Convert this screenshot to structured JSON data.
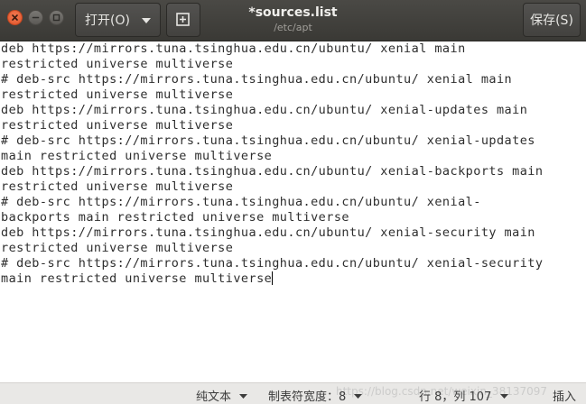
{
  "window": {
    "title": "*sources.list",
    "subtitle": "/etc/apt"
  },
  "header": {
    "open_label": "打开(O)",
    "save_label": "保存(S)"
  },
  "editor": {
    "lines": [
      "deb https://mirrors.tuna.tsinghua.edu.cn/ubuntu/ xenial main",
      "restricted universe multiverse",
      "# deb-src https://mirrors.tuna.tsinghua.edu.cn/ubuntu/ xenial main",
      "restricted universe multiverse",
      "deb https://mirrors.tuna.tsinghua.edu.cn/ubuntu/ xenial-updates main",
      "restricted universe multiverse",
      "# deb-src https://mirrors.tuna.tsinghua.edu.cn/ubuntu/ xenial-updates",
      "main restricted universe multiverse",
      "deb https://mirrors.tuna.tsinghua.edu.cn/ubuntu/ xenial-backports main",
      "restricted universe multiverse",
      "# deb-src https://mirrors.tuna.tsinghua.edu.cn/ubuntu/ xenial-",
      "backports main restricted universe multiverse",
      "deb https://mirrors.tuna.tsinghua.edu.cn/ubuntu/ xenial-security main",
      "restricted universe multiverse",
      "# deb-src https://mirrors.tuna.tsinghua.edu.cn/ubuntu/ xenial-security",
      "main restricted universe multiverse"
    ]
  },
  "status": {
    "language": "纯文本",
    "tab_width": "制表符宽度：8",
    "position": "行 8，列 107",
    "mode": "插入",
    "watermark": "https://blog.csdn.net/weixin_38137097"
  },
  "colors": {
    "header_bg": "#3c3b37",
    "close_button": "#e95420",
    "editor_bg": "#ffffff",
    "statusbar_bg": "#e9e8e6"
  }
}
